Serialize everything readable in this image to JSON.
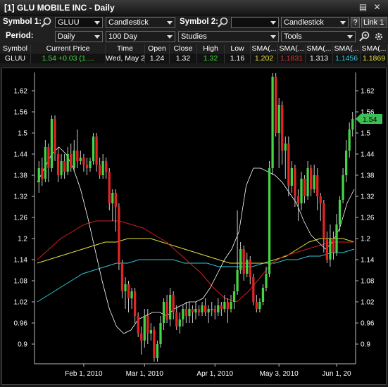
{
  "window": {
    "title": "[1] GLU MOBILE INC - Daily",
    "controls": [
      "▤",
      "✕"
    ]
  },
  "toolbar1": {
    "symbol1_label": "Symbol 1:",
    "symbol1_value": "GLUU",
    "chart_type1": "Candlestick",
    "symbol2_label": "Symbol 2:",
    "symbol2_value": "",
    "chart_type2": "Candlestick",
    "help_label": "?",
    "link_label": "Link 1"
  },
  "toolbar2": {
    "period_label": "Period:",
    "period_value": "Daily",
    "range_value": "100 Day",
    "studies_value": "Studies",
    "tools_value": "Tools"
  },
  "quote": {
    "headers": [
      "Symbol",
      "Current Price",
      "Time",
      "Open",
      "Close",
      "High",
      "Low",
      "SMA(...",
      "SMA(...",
      "SMA(...",
      "SMA(...",
      "SMA(..."
    ],
    "values": [
      "GLUU",
      "1.54  +0.03 (1....",
      "Wed, May 2...",
      "1.24",
      "1.32",
      "1.32",
      "1.16",
      "1.202",
      "1.1831",
      "1.313",
      "1.1456",
      "1.1869"
    ],
    "value_colors": [
      "#ffffff",
      "#3ddc3d",
      "#ffffff",
      "#ffffff",
      "#ffffff",
      "#3ddc3d",
      "#ffffff",
      "#e8e23a",
      "#e03030",
      "#ffffff",
      "#31c8d8",
      "#e8e23a"
    ]
  },
  "chart_data": {
    "type": "candlestick",
    "title": "",
    "y_ticks": [
      0.9,
      0.96,
      1.02,
      1.08,
      1.14,
      1.2,
      1.26,
      1.32,
      1.38,
      1.44,
      1.5,
      1.56,
      1.62
    ],
    "y_tick_labels": [
      "0.9",
      "0.96",
      "1.02",
      "1.08",
      "1.14",
      "1.2",
      "1.26",
      "1.32",
      "1.38",
      "1.44",
      "1.5",
      "1.56",
      "1.62"
    ],
    "ylim": [
      0.86,
      1.66
    ],
    "x_tick_labels": [
      "Feb 1, 2010",
      "Mar 1, 2010",
      "Apr 1, 2010",
      "May 3, 2010",
      "Jun 1, 20"
    ],
    "x_tick_index": [
      14,
      33,
      55,
      75,
      93
    ],
    "current_price_label": "1.54",
    "current_price": 1.54,
    "colors": {
      "up": "#44d444",
      "down": "#e22424",
      "sma_yellow": "#e8e23a",
      "sma_red": "#d02020",
      "sma_cyan": "#31c8d8",
      "sma_white": "#ffffff"
    },
    "candles": [
      [
        1.36,
        1.4,
        1.42,
        1.33
      ],
      [
        1.4,
        1.37,
        1.43,
        1.35
      ],
      [
        1.37,
        1.46,
        1.48,
        1.36
      ],
      [
        1.46,
        1.4,
        1.47,
        1.36
      ],
      [
        1.4,
        1.54,
        1.55,
        1.39
      ],
      [
        1.54,
        1.44,
        1.55,
        1.42
      ],
      [
        1.44,
        1.38,
        1.46,
        1.36
      ],
      [
        1.38,
        1.42,
        1.44,
        1.37
      ],
      [
        1.42,
        1.39,
        1.44,
        1.37
      ],
      [
        1.39,
        1.44,
        1.46,
        1.38
      ],
      [
        1.44,
        1.4,
        1.47,
        1.39
      ],
      [
        1.4,
        1.45,
        1.48,
        1.39
      ],
      [
        1.45,
        1.42,
        1.51,
        1.4
      ],
      [
        1.42,
        1.43,
        1.45,
        1.41
      ],
      [
        1.43,
        1.41,
        1.44,
        1.39
      ],
      [
        1.41,
        1.4,
        1.43,
        1.38
      ],
      [
        1.4,
        1.42,
        1.43,
        1.39
      ],
      [
        1.42,
        1.49,
        1.5,
        1.41
      ],
      [
        1.49,
        1.41,
        1.5,
        1.39
      ],
      [
        1.41,
        1.38,
        1.43,
        1.37
      ],
      [
        1.38,
        1.42,
        1.44,
        1.37
      ],
      [
        1.42,
        1.39,
        1.43,
        1.37
      ],
      [
        1.39,
        1.3,
        1.4,
        1.28
      ],
      [
        1.3,
        1.33,
        1.34,
        1.25
      ],
      [
        1.33,
        1.29,
        1.34,
        1.22
      ],
      [
        1.29,
        1.13,
        1.3,
        1.11
      ],
      [
        1.13,
        1.05,
        1.14,
        1.03
      ],
      [
        1.05,
        1.07,
        1.09,
        1.0
      ],
      [
        1.07,
        1.03,
        1.08,
        0.99
      ],
      [
        1.03,
        1.05,
        1.06,
        1.0
      ],
      [
        1.05,
        0.98,
        1.06,
        0.96
      ],
      [
        0.98,
        0.93,
        0.99,
        0.92
      ],
      [
        0.93,
        0.91,
        0.95,
        0.87
      ],
      [
        0.91,
        0.98,
        1.0,
        0.89
      ],
      [
        0.98,
        0.93,
        1.0,
        0.9
      ],
      [
        0.93,
        0.94,
        0.96,
        0.91
      ],
      [
        0.94,
        0.86,
        0.95,
        0.85
      ],
      [
        0.86,
        0.9,
        0.91,
        0.85
      ],
      [
        0.9,
        0.96,
        0.98,
        0.89
      ],
      [
        0.96,
        1.02,
        1.03,
        0.94
      ],
      [
        1.02,
        0.97,
        1.04,
        0.96
      ],
      [
        0.97,
        1.04,
        1.06,
        0.95
      ],
      [
        1.04,
        0.99,
        1.05,
        0.97
      ],
      [
        0.99,
        0.95,
        1.01,
        0.94
      ],
      [
        0.95,
        0.97,
        0.99,
        0.93
      ],
      [
        0.97,
        1.0,
        1.01,
        0.95
      ],
      [
        1.0,
        0.98,
        1.02,
        0.96
      ],
      [
        0.98,
        1.0,
        1.02,
        0.96
      ],
      [
        1.0,
        0.99,
        1.01,
        0.96
      ],
      [
        0.99,
        1.0,
        1.02,
        0.97
      ],
      [
        1.0,
        0.99,
        1.01,
        0.98
      ],
      [
        0.99,
        1.01,
        1.02,
        0.98
      ],
      [
        1.01,
        0.99,
        1.03,
        0.98
      ],
      [
        0.99,
        1.0,
        1.01,
        0.96
      ],
      [
        1.0,
        1.0,
        1.02,
        0.98
      ],
      [
        1.0,
        0.99,
        1.01,
        0.97
      ],
      [
        0.99,
        1.01,
        1.03,
        0.98
      ],
      [
        1.01,
        1.0,
        1.02,
        0.98
      ],
      [
        1.0,
        1.02,
        1.04,
        0.99
      ],
      [
        1.02,
        1.0,
        1.03,
        0.96
      ],
      [
        1.0,
        1.02,
        1.04,
        0.99
      ],
      [
        1.02,
        1.05,
        1.07,
        1.0
      ],
      [
        1.05,
        1.11,
        1.28,
        1.04
      ],
      [
        1.11,
        1.17,
        1.19,
        1.1
      ],
      [
        1.17,
        1.1,
        1.18,
        1.08
      ],
      [
        1.1,
        1.14,
        1.16,
        1.09
      ],
      [
        1.14,
        1.09,
        1.15,
        1.07
      ],
      [
        1.09,
        1.02,
        1.1,
        1.01
      ],
      [
        1.02,
        1.0,
        1.04,
        0.99
      ],
      [
        1.0,
        1.02,
        1.03,
        0.99
      ],
      [
        1.02,
        1.06,
        1.07,
        1.01
      ],
      [
        1.06,
        1.1,
        1.12,
        1.05
      ],
      [
        1.1,
        1.4,
        1.42,
        1.09
      ],
      [
        1.4,
        1.66,
        1.67,
        1.38
      ],
      [
        1.66,
        1.5,
        1.67,
        1.49
      ],
      [
        1.5,
        1.58,
        1.6,
        1.4
      ],
      [
        1.58,
        1.45,
        1.59,
        1.41
      ],
      [
        1.45,
        1.47,
        1.49,
        1.37
      ],
      [
        1.47,
        1.35,
        1.49,
        1.32
      ],
      [
        1.35,
        1.4,
        1.42,
        1.33
      ],
      [
        1.4,
        1.32,
        1.41,
        1.29
      ],
      [
        1.32,
        1.3,
        1.34,
        1.25
      ],
      [
        1.3,
        1.37,
        1.39,
        1.28
      ],
      [
        1.37,
        1.32,
        1.38,
        1.3
      ],
      [
        1.32,
        1.4,
        1.42,
        1.31
      ],
      [
        1.4,
        1.34,
        1.41,
        1.32
      ],
      [
        1.34,
        1.38,
        1.41,
        1.33
      ],
      [
        1.38,
        1.32,
        1.4,
        1.28
      ],
      [
        1.32,
        1.3,
        1.33,
        1.25
      ],
      [
        1.3,
        1.2,
        1.31,
        1.16
      ],
      [
        1.2,
        1.14,
        1.22,
        1.13
      ],
      [
        1.14,
        1.2,
        1.24,
        1.12
      ],
      [
        1.2,
        1.16,
        1.22,
        1.14
      ],
      [
        1.16,
        1.24,
        1.27,
        1.15
      ],
      [
        1.24,
        1.31,
        1.32,
        1.22
      ],
      [
        1.31,
        1.38,
        1.4,
        1.3
      ],
      [
        1.38,
        1.45,
        1.48,
        1.36
      ],
      [
        1.45,
        1.51,
        1.53,
        1.43
      ],
      [
        1.51,
        1.54,
        1.56,
        1.49
      ]
    ],
    "sma_yellow": [
      1.13,
      1.14,
      1.15,
      1.16,
      1.17,
      1.18,
      1.19,
      1.19,
      1.2,
      1.2,
      1.2,
      1.19,
      1.18,
      1.17,
      1.16,
      1.15,
      1.14,
      1.13,
      1.13,
      1.13,
      1.13,
      1.14,
      1.15,
      1.17,
      1.19,
      1.2,
      1.2,
      1.2,
      1.19
    ],
    "sma_red": [
      1.14,
      1.17,
      1.2,
      1.22,
      1.24,
      1.25,
      1.25,
      1.25,
      1.24,
      1.23,
      1.21,
      1.19,
      1.16,
      1.13,
      1.1,
      1.06,
      1.03,
      1.02,
      1.05,
      1.09,
      1.13,
      1.15,
      1.16,
      1.17,
      1.18,
      1.19,
      1.19,
      1.19
    ],
    "sma_cyan": [
      1.02,
      1.04,
      1.06,
      1.08,
      1.1,
      1.11,
      1.12,
      1.13,
      1.13,
      1.14,
      1.14,
      1.14,
      1.14,
      1.13,
      1.13,
      1.13,
      1.12,
      1.12,
      1.12,
      1.12,
      1.13,
      1.13,
      1.14,
      1.14,
      1.15,
      1.15,
      1.16,
      1.16,
      1.17
    ],
    "sma_white": [
      1.36,
      1.4,
      1.44,
      1.46,
      1.44,
      1.4,
      1.34,
      1.26,
      1.17,
      1.08,
      1.0,
      0.95,
      0.93,
      0.94,
      0.97,
      0.98,
      0.99,
      0.99,
      0.98,
      1.0,
      1.01,
      1.02,
      1.02,
      1.03,
      1.06,
      1.1,
      1.14,
      1.17,
      1.22,
      1.35,
      1.4,
      1.4,
      1.39,
      1.38,
      1.36,
      1.33,
      1.3,
      1.25,
      1.21,
      1.19,
      1.17,
      1.19,
      1.23,
      1.3,
      1.34
    ]
  }
}
